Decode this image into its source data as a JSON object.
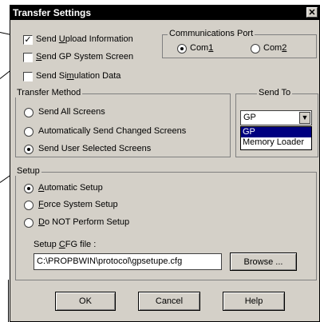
{
  "title": "Transfer Settings",
  "close_glyph": "✕",
  "checkboxes": [
    {
      "pre": "Send ",
      "u": "U",
      "post": "pload Information",
      "checked": true
    },
    {
      "pre": "",
      "u": "S",
      "post": "end GP System Screen",
      "checked": false
    },
    {
      "pre": "Send Si",
      "u": "m",
      "post": "ulation Data",
      "checked": false
    }
  ],
  "comm_port": {
    "legend": "Communications Port",
    "options": [
      {
        "pre": "Com",
        "u": "1",
        "selected": true
      },
      {
        "pre": "Com",
        "u": "2",
        "selected": false
      }
    ]
  },
  "transfer_method": {
    "legend": "Transfer Method",
    "options": [
      {
        "label": "Send All Screens",
        "selected": false
      },
      {
        "label": "Automatically Send Changed Screens",
        "selected": false
      },
      {
        "label": "Send User Selected Screens",
        "selected": true
      }
    ]
  },
  "send_to": {
    "legend": "Send To",
    "value": "GP",
    "options": [
      "GP",
      "Memory Loader"
    ],
    "highlighted": "GP"
  },
  "setup": {
    "legend": "Setup",
    "options": [
      {
        "u": "A",
        "post": "utomatic Setup",
        "selected": true
      },
      {
        "u": "F",
        "post": "orce System Setup",
        "selected": false
      },
      {
        "u": "D",
        "post": "o NOT Perform Setup",
        "selected": false
      }
    ],
    "cfg_label_pre": "Setup ",
    "cfg_label_u": "C",
    "cfg_label_post": "FG file :",
    "cfg_value": "C:\\PROPBWIN\\protocol\\gpsetupe.cfg",
    "browse_label": "Browse ..."
  },
  "buttons": {
    "ok": "OK",
    "cancel": "Cancel",
    "help": "Help"
  },
  "colors": {
    "dialog_bg": "#d4d0c8",
    "titlebar": "#000000",
    "highlight": "#000080"
  }
}
